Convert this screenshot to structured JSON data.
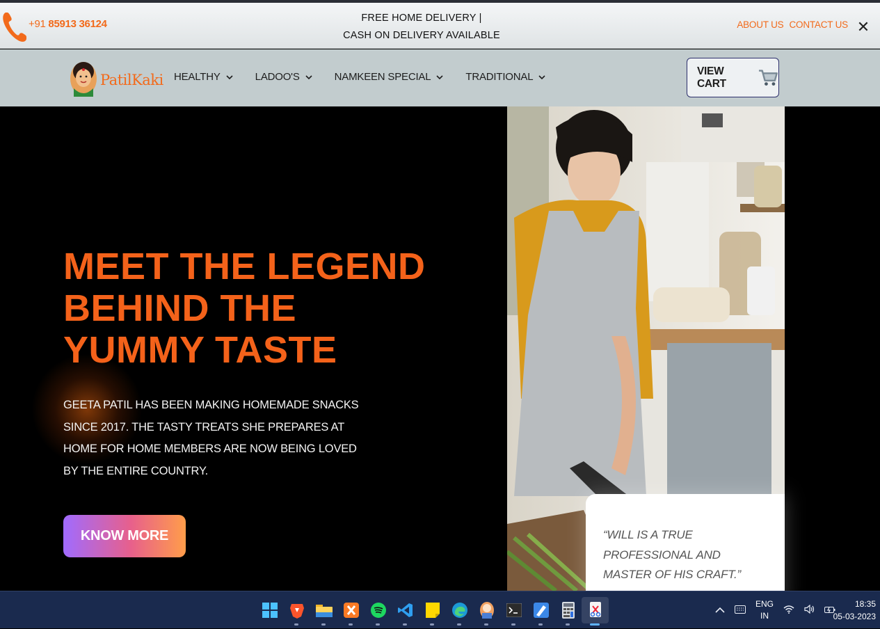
{
  "announcement": {
    "phone_prefix": "+91",
    "phone_number": "85913 36124",
    "promo_line1": "FREE HOME DELIVERY |",
    "promo_line2": "CASH ON DELIVERY AVAILABLE",
    "about_label": "ABOUT US",
    "contact_label": "CONTACT US",
    "close_symbol": "✕"
  },
  "nav": {
    "logo_text": "PatilKaki",
    "menu": [
      {
        "label": "HEALTHY"
      },
      {
        "label": "LADOO'S"
      },
      {
        "label": "NAMKEEN SPECIAL"
      },
      {
        "label": "TRADITIONAL"
      }
    ],
    "cart_label": "VIEW CART"
  },
  "hero": {
    "headline_line1": "MEET THE LEGEND",
    "headline_line2": "BEHIND THE",
    "headline_line3": "YUMMY TASTE",
    "blurb": "GEETA PATIL HAS BEEN MAKING HOMEMADE SNACKS SINCE 2017. THE TASTY TREATS SHE PREPARES AT HOME FOR HOME MEMBERS ARE NOW BEING LOVED BY THE ENTIRE COUNTRY.",
    "cta_label": "KNOW MORE",
    "quote": "“WILL IS A TRUE PROFESSIONAL AND MASTER OF HIS CRAFT.”"
  },
  "taskbar": {
    "apps": [
      "start-icon",
      "brave-browser-icon",
      "file-explorer-icon",
      "xampp-icon",
      "spotify-icon",
      "vscode-icon",
      "sticky-notes-icon",
      "edge-browser-icon",
      "chat-app-icon",
      "terminal-icon",
      "paint-icon",
      "calculator-icon",
      "snipping-tool-icon"
    ],
    "lang_line1": "ENG",
    "lang_line2": "IN",
    "time": "18:35",
    "date": "05-03-2023"
  },
  "colors": {
    "accent": "#f4621a",
    "navbar_bg": "#c2ccce",
    "taskbar_bg": "#1a2a4e"
  }
}
